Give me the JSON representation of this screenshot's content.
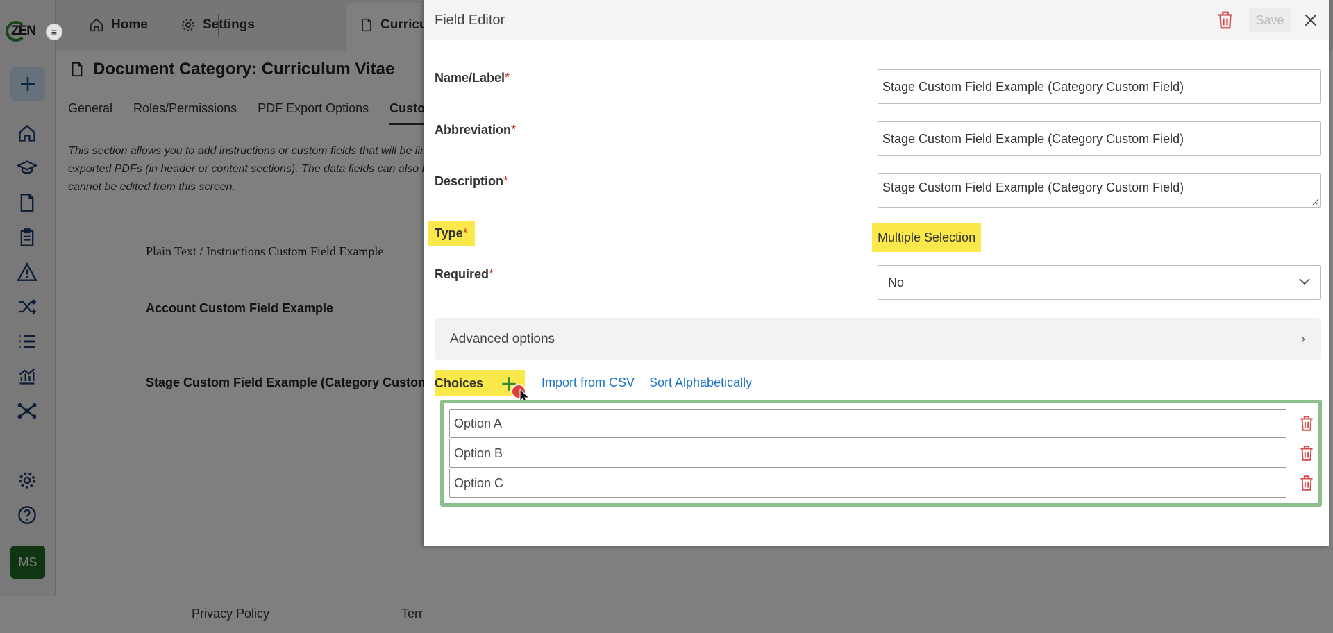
{
  "app": {
    "logo_text": "ZEN",
    "menu_toggle_glyph": "≡",
    "avatar_initials": "MS",
    "nav_icons": [
      "home-icon",
      "graduation-cap-icon",
      "document-icon",
      "clipboard-icon",
      "warning-icon",
      "shuffle-icon",
      "list-icon",
      "chart-icon",
      "network-icon",
      "gear-icon",
      "help-icon"
    ]
  },
  "topbar": {
    "tabs": [
      {
        "label": "Home",
        "icon": "home-icon"
      },
      {
        "label": "Settings",
        "icon": "gear-icon"
      },
      {
        "label": "Curricu",
        "icon": "document-icon"
      }
    ]
  },
  "page": {
    "title": "Document Category: Curriculum Vitae",
    "subtabs": [
      "General",
      "Roles/Permissions",
      "PDF Export Options",
      "Custom"
    ],
    "info_lines": [
      "This section allows you to add instructions or custom fields that will be linked",
      "exported PDFs (in header or content sections). The data fields can also be use",
      "cannot be edited from this screen."
    ],
    "fields": [
      "Plain Text / Instructions Custom Field Example",
      "Account Custom Field Example",
      "Stage Custom Field Example (Category Custom Fiel"
    ],
    "footer": [
      "Privacy Policy",
      "Terr"
    ]
  },
  "modal": {
    "title": "Field Editor",
    "save_label": "Save",
    "name_label": "Name/Label",
    "name_value": "Stage Custom Field Example (Category Custom Field)",
    "abbreviation_label": "Abbreviation",
    "abbreviation_value": "Stage Custom Field Example (Category Custom Field)",
    "description_label": "Description",
    "description_value": "Stage Custom Field Example (Category Custom Field)",
    "type_label": "Type",
    "type_value": "Multiple Selection",
    "required_label": "Required",
    "required_value": "No",
    "required_marker": "*",
    "advanced_label": "Advanced options",
    "advanced_chevron": "›",
    "choices_label": "Choices",
    "import_csv_label": "Import from CSV",
    "sort_label": "Sort Alphabetically",
    "choices": [
      "Option A",
      "Option B",
      "Option C"
    ]
  },
  "colors": {
    "highlight": "#fbe84a",
    "link": "#1a73c8",
    "delete": "#d44d4d",
    "add": "#2e8b3d",
    "choices_border": "#8dbf8d"
  }
}
